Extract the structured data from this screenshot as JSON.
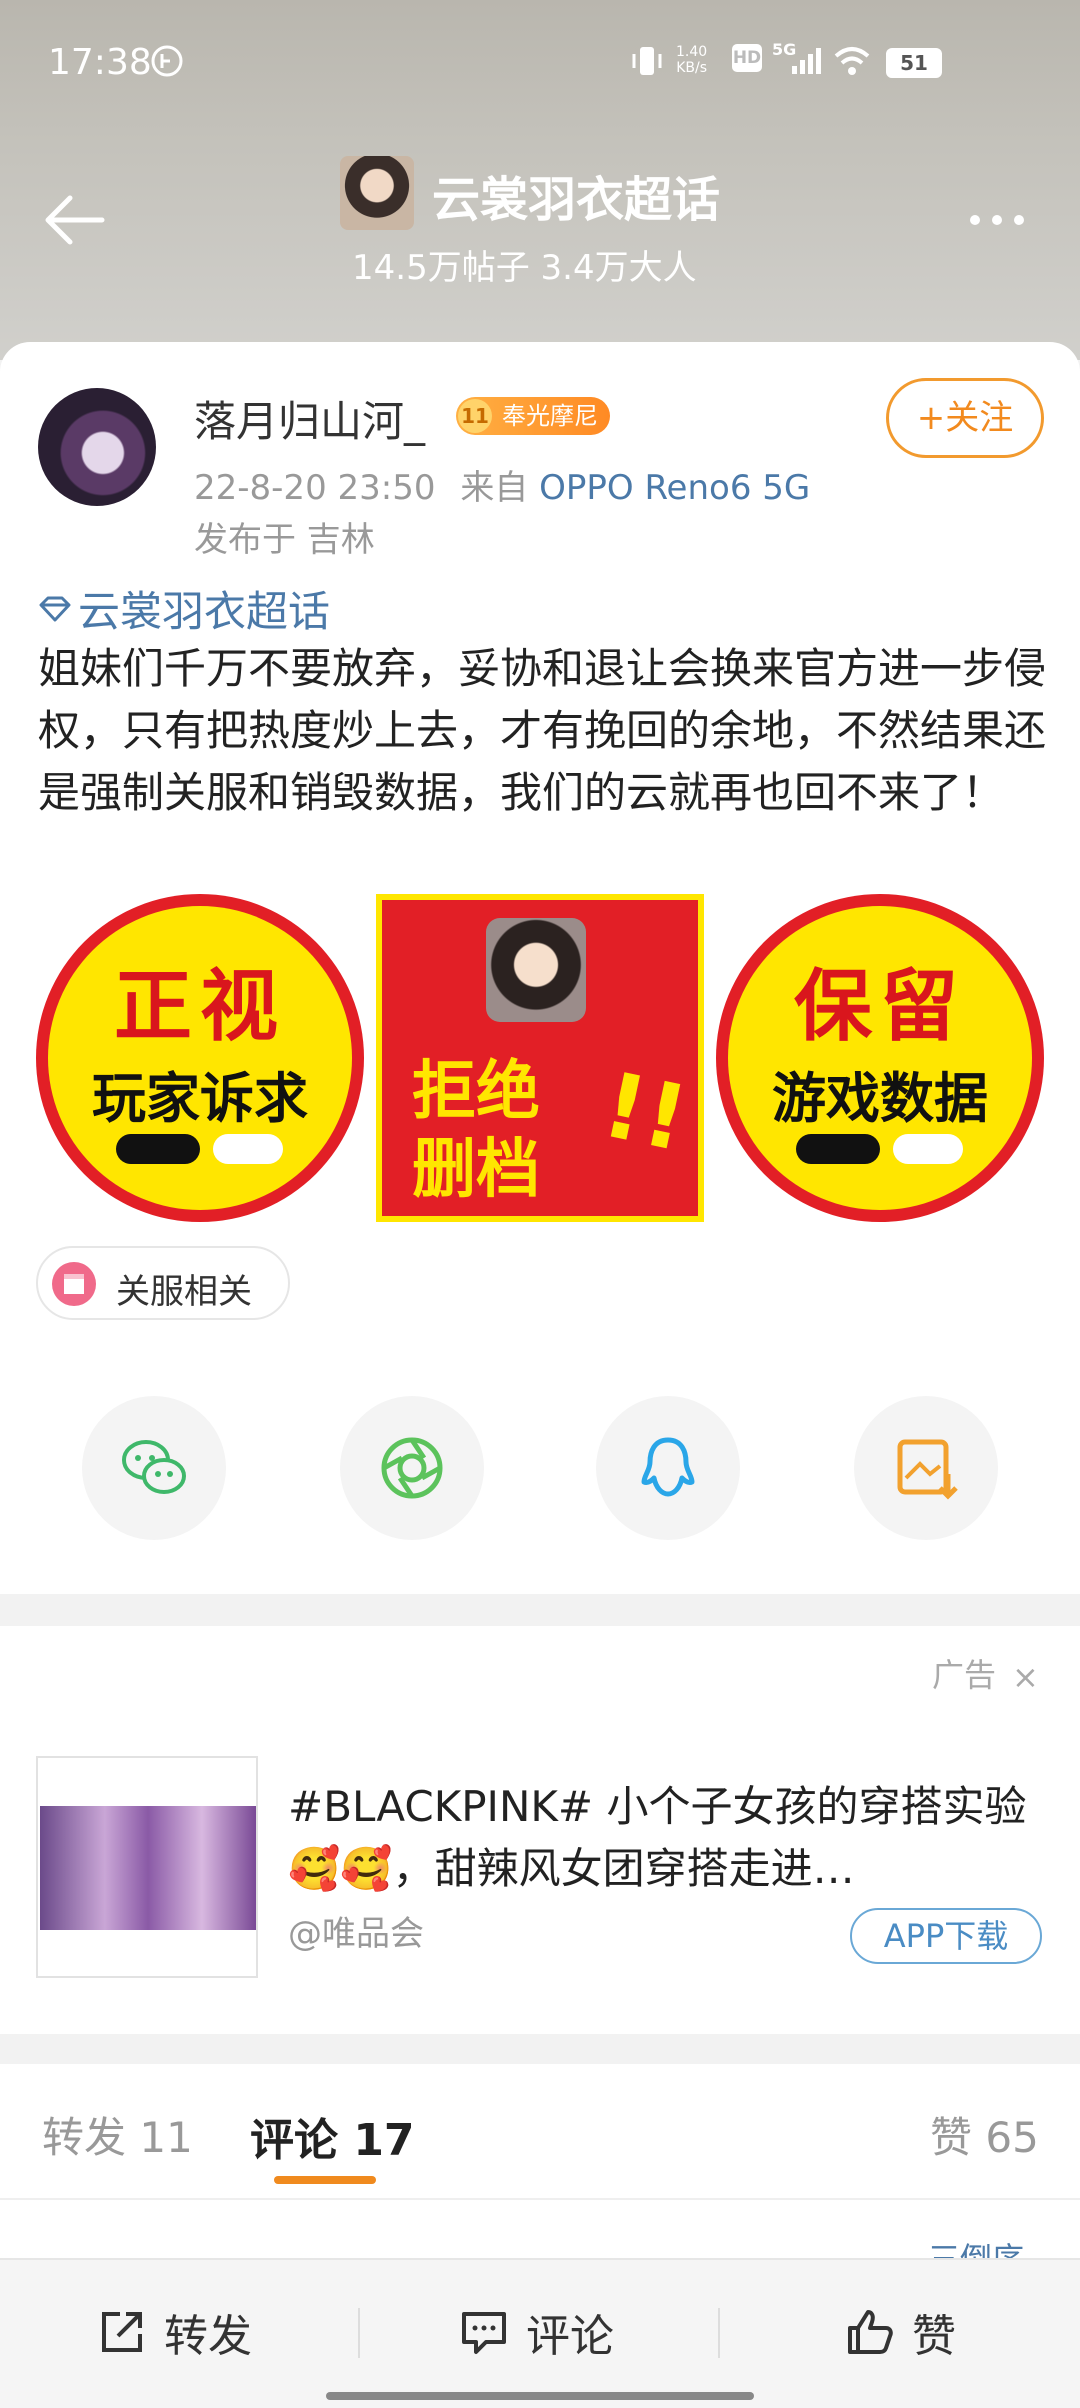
{
  "status_bar": {
    "time": "17:38",
    "net_speed_value": "1.40",
    "net_speed_unit": "KB/s",
    "hd_label": "HD",
    "network": "5G",
    "battery": "51"
  },
  "nav": {
    "title": "云裳羽衣超话",
    "subtitle": "14.5万帖子 3.4万大人"
  },
  "post": {
    "author": "落月归山河_",
    "badge_level": "11",
    "badge_text": "奉光摩尼",
    "follow_label": "+关注",
    "date": "22-8-20 23:50",
    "source_prefix": "来自",
    "source": "OPPO Reno6 5G",
    "location": "发布于 吉林",
    "topic": "云裳羽衣超话",
    "text": "姐妹们千万不要放弃，妥协和退让会换来官方进一步侵权，只有把热度炒上去，才有挽回的余地，不然结果还是强制关服和销毁数据，我们的云就再也回不来了！",
    "images": [
      {
        "line1": "正视",
        "line2": "玩家诉求"
      },
      {
        "line1": "拒绝",
        "line2": "删档",
        "mark": "!!"
      },
      {
        "line1": "保留",
        "line2": "游戏数据"
      }
    ],
    "tag": "关服相关"
  },
  "share": [
    "wechat-icon",
    "moments-icon",
    "qq-icon",
    "save-image-icon"
  ],
  "ad": {
    "label": "广告",
    "close": "×",
    "title": "#BLACKPINK# 小个子女孩的穿搭实验 🥰🥰，甜辣风女团穿搭走进…",
    "source": "@唯品会",
    "download": "APP下载"
  },
  "tabs": {
    "repost": "转发 11",
    "comment": "评论 17",
    "like": "赞 65",
    "sort_peek": "三倒序"
  },
  "actions": {
    "repost": "转发",
    "comment": "评论",
    "like": "赞"
  },
  "colors": {
    "accent": "#f08a1e",
    "link": "#4b79a8"
  }
}
